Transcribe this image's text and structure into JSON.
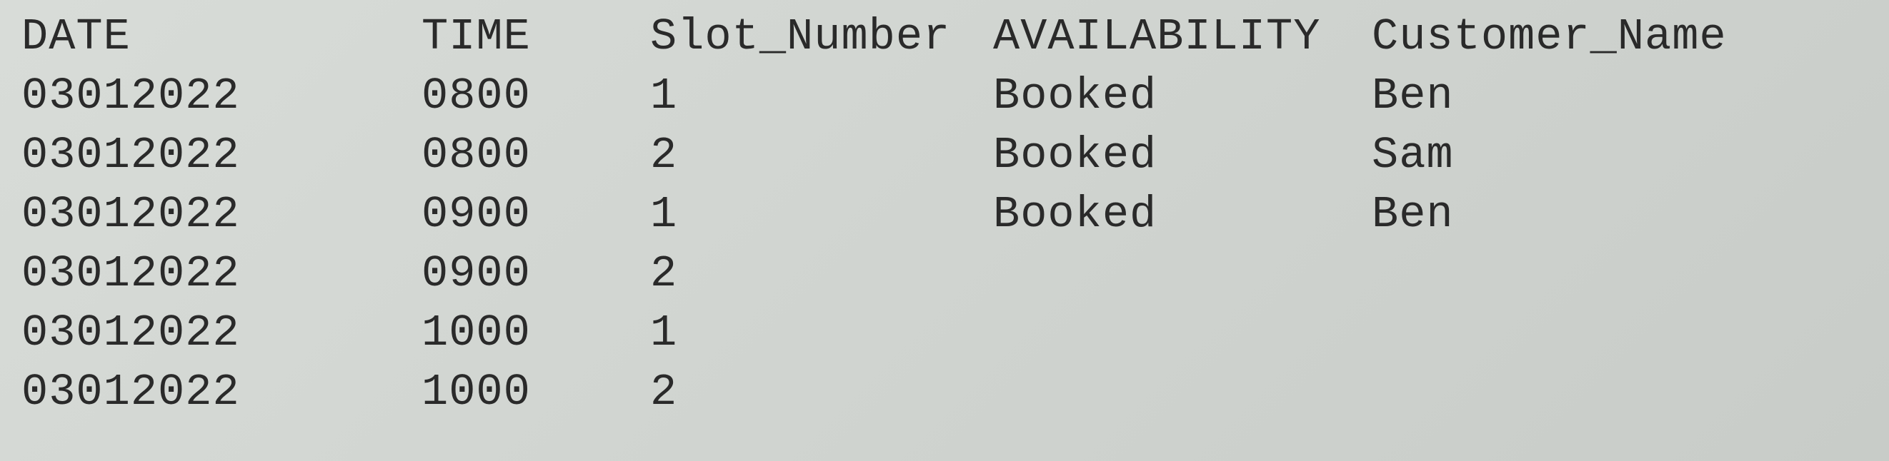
{
  "table": {
    "headers": {
      "date": "DATE",
      "time": "TIME",
      "slot": "Slot_Number",
      "availability": "AVAILABILITY",
      "customer": "Customer_Name"
    },
    "rows": [
      {
        "date": "03012022",
        "time": "0800",
        "slot": "1",
        "availability": "Booked",
        "customer": "Ben"
      },
      {
        "date": "03012022",
        "time": "0800",
        "slot": "2",
        "availability": "Booked",
        "customer": "Sam"
      },
      {
        "date": "03012022",
        "time": "0900",
        "slot": "1",
        "availability": "Booked",
        "customer": "Ben"
      },
      {
        "date": "03012022",
        "time": "0900",
        "slot": "2",
        "availability": "",
        "customer": ""
      },
      {
        "date": "03012022",
        "time": "1000",
        "slot": "1",
        "availability": "",
        "customer": ""
      },
      {
        "date": "03012022",
        "time": "1000",
        "slot": "2",
        "availability": "",
        "customer": ""
      }
    ]
  }
}
